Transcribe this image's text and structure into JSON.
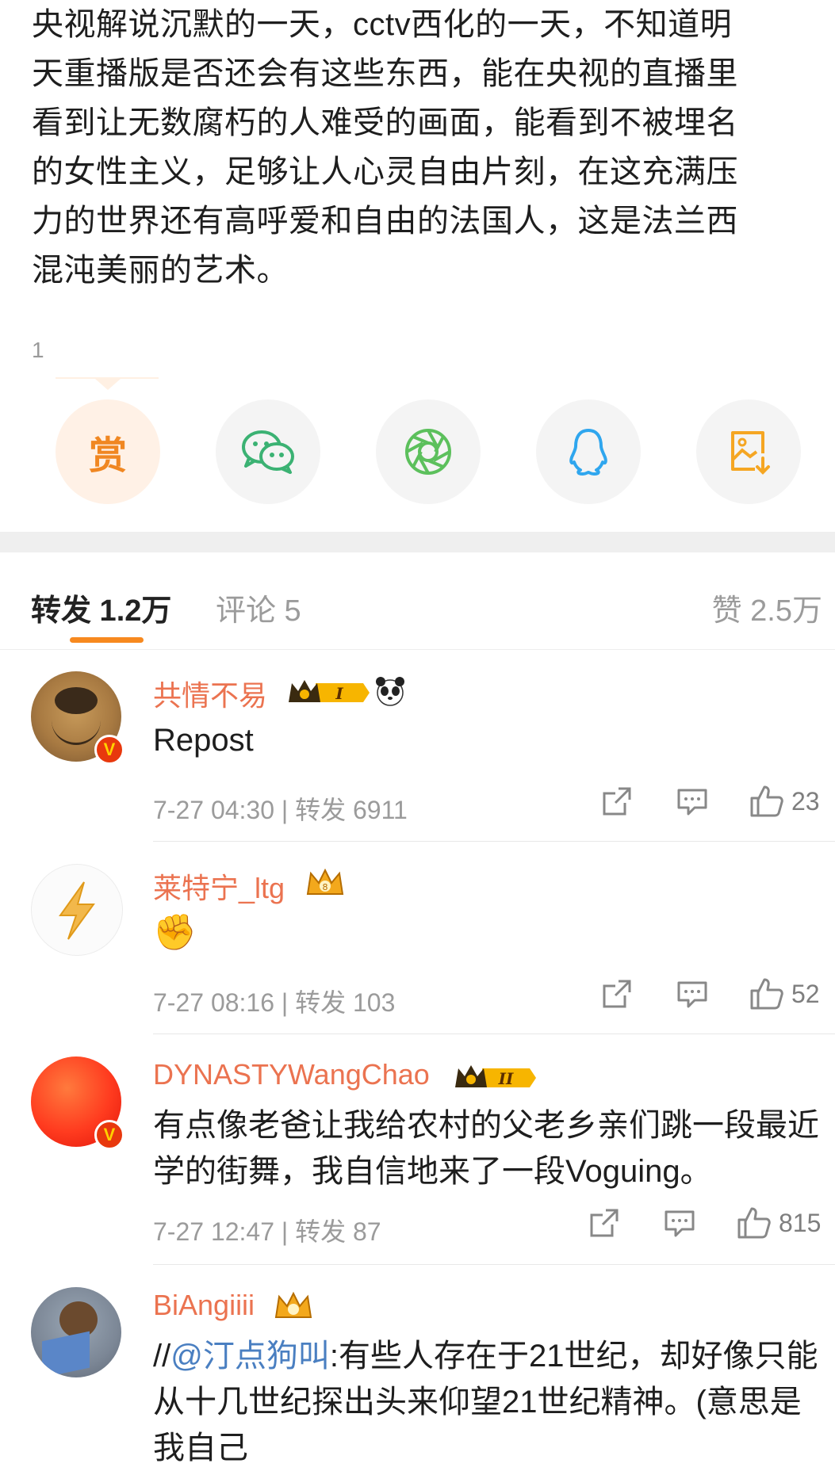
{
  "post": {
    "text": "央视解说沉默的一天，cctv西化的一天，不知道明\n天重播版是否还会有这些东西，能在央视的直播里\n看到让无数腐朽的人难受的画面，能看到不被埋名\n的女性主义，足够让人心灵自由片刻，在这充满压\n力的世界还有高呼爱和自由的法国人，这是法兰西\n混沌美丽的艺术。",
    "reward_count": "1"
  },
  "share": {
    "reward_label": "赏",
    "items": [
      "reward-button",
      "wechat-share-button",
      "moments-share-button",
      "qq-share-button",
      "save-image-button"
    ]
  },
  "tabs": {
    "repost": "转发 1.2万",
    "comments": "评论 5",
    "likes": "赞 2.5万"
  },
  "comments": [
    {
      "name": "共情不易",
      "text": "Repost",
      "time": "7-27 04:30",
      "repost": "转发 6911",
      "likes": "23",
      "verified": true
    },
    {
      "name": "莱特宁_ltg",
      "text": "✊",
      "time": "7-27 08:16",
      "repost": "转发 103",
      "likes": "52",
      "verified": false
    },
    {
      "name": "DYNASTYWangChao",
      "text": "有点像老爸让我给农村的父老乡亲们跳一段最近学的街舞，我自信地来了一段Voguing。",
      "time": "7-27 12:47",
      "repost": "转发 87",
      "likes": "815",
      "verified": true
    },
    {
      "name": "BiAngiiii",
      "text_prefix": "//",
      "mention": "@汀点狗叫",
      "text": ":有些人存在于21世纪，却好像只能从十几世纪探出头来仰望21世纪精神。(意思是我自己",
      "verified": false
    }
  ],
  "meta_sep": " | ",
  "colors": {
    "accent": "#f7891f",
    "username": "#eb7350",
    "mention": "#4a7fc1",
    "verified": "#e8380d"
  }
}
